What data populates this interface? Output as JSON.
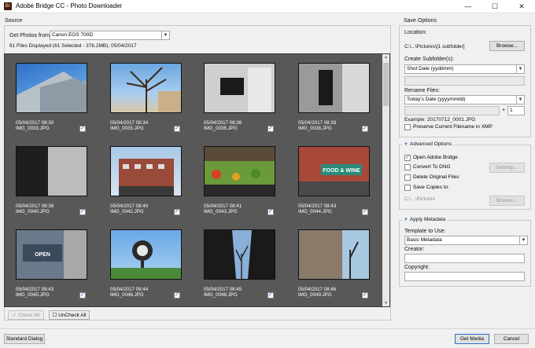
{
  "window": {
    "title": "Adobe Bridge CC - Photo Downloader",
    "app_icon": "Br",
    "minimize": "—",
    "maximize": "☐",
    "close": "✕"
  },
  "source": {
    "section_label": "Source",
    "get_photos_label": "Get Photos from:",
    "device": "Canon EOS 700D",
    "summary": "61 Files Displayed (61 Selected - 376.2MB); 05/04/2017"
  },
  "thumbnails": [
    {
      "date": "05/04/2017 08:30",
      "name": "IMG_0033.JPG",
      "checked": true
    },
    {
      "date": "05/04/2017 08:34",
      "name": "IMG_0035.JPG",
      "checked": true
    },
    {
      "date": "05/04/2017 08:36",
      "name": "IMG_0036.JPG",
      "checked": true
    },
    {
      "date": "05/04/2017 08:38",
      "name": "IMG_0038.JPG",
      "checked": true
    },
    {
      "date": "05/04/2017 08:38",
      "name": "IMG_0040.JPG",
      "checked": true
    },
    {
      "date": "05/04/2017 08:40",
      "name": "IMG_0042.JPG",
      "checked": true
    },
    {
      "date": "05/04/2017 08:41",
      "name": "IMG_0043.JPG",
      "checked": true
    },
    {
      "date": "05/04/2017 08:43",
      "name": "IMG_0044.JPG",
      "checked": true
    },
    {
      "date": "05/04/2017 08:43",
      "name": "IMG_0045.JPG",
      "checked": true
    },
    {
      "date": "05/04/2017 08:44",
      "name": "IMG_0046.JPG",
      "checked": true
    },
    {
      "date": "05/04/2017 08:45",
      "name": "IMG_0048.JPG",
      "checked": true
    },
    {
      "date": "05/04/2017 08:46",
      "name": "IMG_0049.JPG",
      "checked": true
    }
  ],
  "thumb_signs": {
    "food_wine": "FOOD & WINE",
    "open": "OPEN"
  },
  "check_buttons": {
    "check_all": "Check All",
    "uncheck_all": "UnCheck All"
  },
  "save_options": {
    "section_label": "Save Options",
    "location_label": "Location:",
    "location_value": "C:\\...\\Pictures\\[1 subfolder]",
    "browse_label": "Browse...",
    "subfolder_label": "Create Subfolder(s):",
    "subfolder_value": "Shot Date (yyddmm)",
    "rename_label": "Rename Files:",
    "rename_value": "Today's Date (yyyymmdd)",
    "plus": "+",
    "sequence_value": "1",
    "example": "Example:  20170712_0001.JPG",
    "preserve_label": "Preserve Current Filename in XMP"
  },
  "advanced": {
    "header": "Advanced Options",
    "open_bridge": "Open Adobe Bridge",
    "convert_dng": "Convert To DNG",
    "settings_label": "Settings...",
    "delete_originals": "Delete Original Files",
    "save_copies": "Save Copies to:",
    "copies_path": "C:\\...\\Pictures",
    "browse_label": "Browse..."
  },
  "metadata": {
    "header": "Apply Metadata",
    "template_label": "Template to Use:",
    "template_value": "Basic Metadata",
    "creator_label": "Creator:",
    "copyright_label": "Copyright:"
  },
  "footer": {
    "standard_dialog": "Standard Dialog",
    "get_media": "Get Media",
    "cancel": "Cancel"
  },
  "colors": {
    "accent": "#3a7bd5",
    "thumb_bg": "#585858"
  }
}
